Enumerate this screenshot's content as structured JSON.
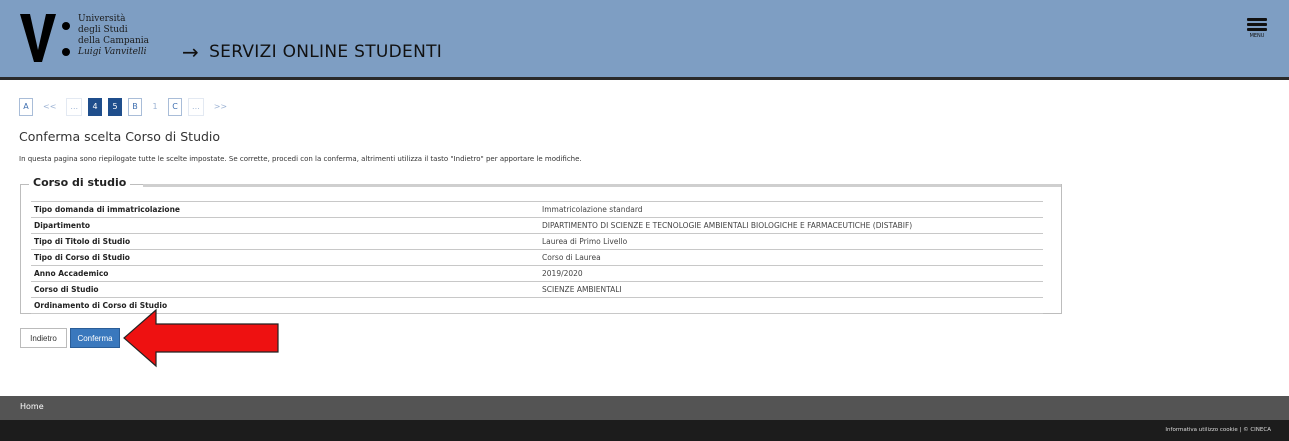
{
  "header": {
    "logo_letter": "V",
    "university_lines": [
      "Università",
      "degli Studi",
      "della Campania",
      "Luigi Vanvitelli"
    ],
    "title": "SERVIZI ONLINE STUDENTI",
    "menu_label": "MENU"
  },
  "steps": [
    {
      "label": "A",
      "style": "box"
    },
    {
      "label": "<<",
      "style": "bare"
    },
    {
      "label": "...",
      "style": "dim"
    },
    {
      "label": "4",
      "style": "active"
    },
    {
      "label": "5",
      "style": "active"
    },
    {
      "label": "B",
      "style": "box"
    },
    {
      "label": "1",
      "style": "bare"
    },
    {
      "label": "C",
      "style": "box"
    },
    {
      "label": "...",
      "style": "dim"
    },
    {
      "label": ">>",
      "style": "bare"
    }
  ],
  "page": {
    "title": "Conferma scelta Corso di Studio",
    "intro": "In questa pagina sono riepilogate tutte le scelte impostate. Se corrette, procedi con la conferma, altrimenti utilizza il tasto \"Indietro\" per apportare le modifiche."
  },
  "fieldset": {
    "legend": "Corso di studio",
    "rows": [
      {
        "label": "Tipo domanda di immatricolazione",
        "value": "Immatricolazione standard"
      },
      {
        "label": "Dipartimento",
        "value": "DIPARTIMENTO DI SCIENZE E TECNOLOGIE AMBIENTALI BIOLOGICHE E FARMACEUTICHE (DISTABIF)"
      },
      {
        "label": "Tipo di Titolo di Studio",
        "value": "Laurea di Primo Livello"
      },
      {
        "label": "Tipo di Corso di Studio",
        "value": "Corso di Laurea"
      },
      {
        "label": "Anno Accademico",
        "value": "2019/2020"
      },
      {
        "label": "Corso di Studio",
        "value": "SCIENZE AMBIENTALI"
      },
      {
        "label": "Ordinamento di Corso di Studio",
        "value": ""
      }
    ]
  },
  "buttons": {
    "back": "Indietro",
    "confirm": "Conferma"
  },
  "annotation": {
    "arrow_color": "#ee1111"
  },
  "footer": {
    "nav_link": "Home",
    "bottom_text": "Informativa utilizzo cookie | © CINECA"
  }
}
